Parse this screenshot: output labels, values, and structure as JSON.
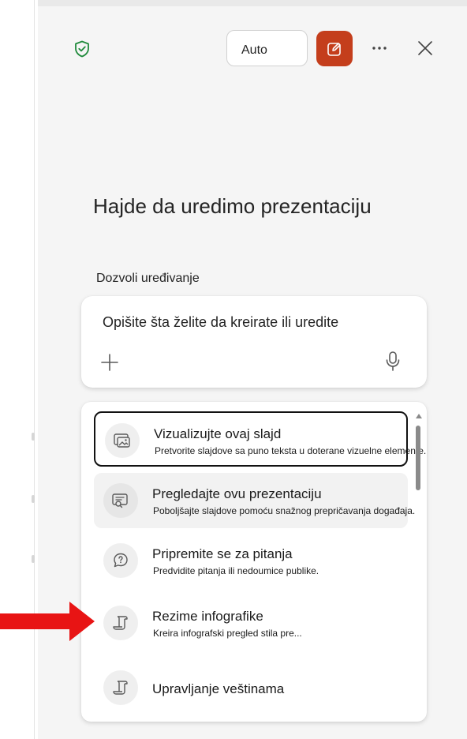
{
  "header": {
    "mode_label": "Auto",
    "icons": {
      "security": "shield-check-icon",
      "new_chat": "compose-icon",
      "more": "more-horizontal-icon",
      "close": "close-icon"
    }
  },
  "main": {
    "heading": "Hajde da uredimo prezentaciju",
    "edit_label": "Dozvoli uređivanje",
    "composer": {
      "placeholder": "Opišite šta želite da kreirate ili uredite",
      "add_icon": "plus-icon",
      "mic_icon": "microphone-icon"
    },
    "suggestions": [
      {
        "title": "Vizualizujte ovaj slajd",
        "description": "Pretvorite slajdove sa puno teksta u doterane vizuelne elemente.",
        "icon": "image-slide-icon",
        "state": "focused"
      },
      {
        "title": "Pregledajte ovu prezentaciju",
        "description": "Poboljšajte slajdove pomoću snažnog prepričavanja događaja.",
        "icon": "review-slide-icon",
        "state": "hovered"
      },
      {
        "title": "Pripremite se za pitanja",
        "description": "Predvidite pitanja ili nedoumice publike.",
        "icon": "question-chat-icon",
        "state": "normal"
      },
      {
        "title": "Rezime infografike",
        "description": "Kreira infografski pregled stila pre...",
        "icon": "scroll-icon",
        "state": "normal"
      },
      {
        "title": "Upravljanje veštinama",
        "description": "",
        "icon": "scroll-icon",
        "state": "normal"
      }
    ]
  },
  "annotation": {
    "arrow_icon": "red-arrow-icon",
    "arrow_color": "#e81414"
  },
  "colors": {
    "accent": "#c43e1c",
    "success": "#1f8a3b",
    "pane_background": "#f5f5f5"
  }
}
